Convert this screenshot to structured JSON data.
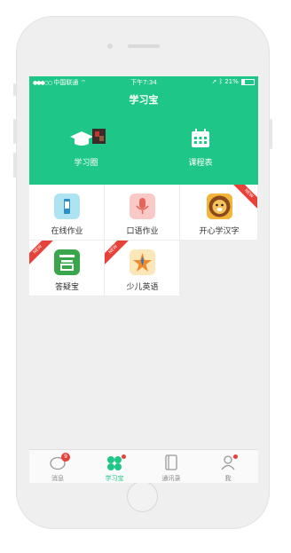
{
  "status_bar": {
    "carrier": "中国联通",
    "time": "下午7:34",
    "battery": "21%"
  },
  "header": {
    "title": "学习宝",
    "items": [
      {
        "label": "学习圈",
        "icon": "graduation-cap-icon"
      },
      {
        "label": "课程表",
        "icon": "calendar-icon"
      }
    ]
  },
  "apps": [
    {
      "label": "在线作业",
      "icon": "pencil-icon",
      "color": "#aee3f1",
      "new": false
    },
    {
      "label": "口语作业",
      "icon": "microphone-icon",
      "color": "#f9c9c5",
      "new": false
    },
    {
      "label": "开心学汉字",
      "icon": "lion-icon",
      "color": "#f3b43a",
      "new": true
    },
    {
      "label": "答疑宝",
      "icon": "answer-icon",
      "color": "#3aa64b",
      "new": true
    },
    {
      "label": "少儿英语",
      "icon": "star-icon",
      "color": "#fbe7b8",
      "new": true
    }
  ],
  "new_ribbon": "NEW",
  "tabbar": {
    "tabs": [
      {
        "label": "消息",
        "badge": "9"
      },
      {
        "label": "学习宝",
        "active": true
      },
      {
        "label": "通讯录"
      },
      {
        "label": "我"
      }
    ]
  },
  "colors": {
    "brand": "#1ec787",
    "badge": "#e8413a"
  }
}
